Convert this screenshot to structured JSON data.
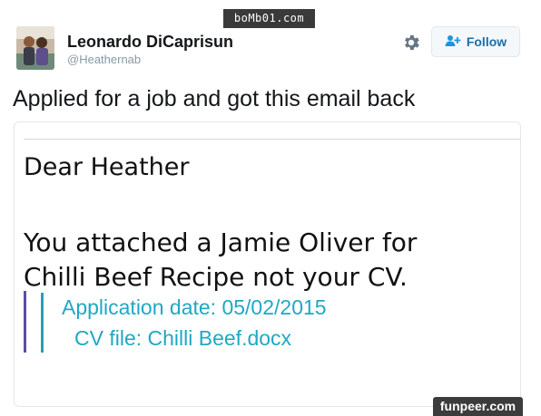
{
  "watermark_top": "boMb01.com",
  "user": {
    "name": "Leonardo DiCaprisun",
    "handle": "@Heathernab"
  },
  "actions": {
    "settings_icon": "gear-icon",
    "follow_icon": "person-add-icon",
    "follow_label": "Follow"
  },
  "tweet": {
    "text": "Applied for a job and got this email back"
  },
  "email": {
    "greeting": "Dear Heather",
    "line1": "You attached a Jamie Oliver for",
    "line2": "Chilli Beef Recipe not your CV.",
    "application_date": "Application date: 05/02/2015",
    "cv_file": "CV file: Chilli Beef.docx"
  },
  "watermark_bottom": "funpeer.com",
  "colors": {
    "follow_text": "#1b6ea8",
    "quote_text": "#1fa8c4",
    "quote_bar_1": "#5b4ea8",
    "quote_bar_2": "#27a0b6"
  }
}
